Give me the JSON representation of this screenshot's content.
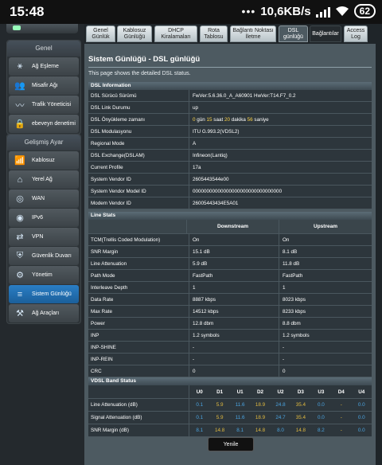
{
  "statusbar": {
    "time": "15:48",
    "dots": "•••",
    "speed": "10,6KB/s",
    "battery": "62"
  },
  "sidebar": {
    "general_title": "Genel",
    "general_items": [
      {
        "label": "Ağ Eşleme",
        "icon": "network-map-icon"
      },
      {
        "label": "Misafir Ağı",
        "icon": "guest-network-icon"
      },
      {
        "label": "Trafik Yöneticisi",
        "icon": "traffic-manager-icon"
      },
      {
        "label": "ebeveyn denetimi",
        "icon": "parental-control-icon"
      }
    ],
    "advanced_title": "Gelişmiş Ayar",
    "advanced_items": [
      {
        "label": "Kablosuz",
        "icon": "wireless-icon"
      },
      {
        "label": "Yerel Ağ",
        "icon": "lan-icon"
      },
      {
        "label": "WAN",
        "icon": "globe-icon"
      },
      {
        "label": "IPv6",
        "icon": "ipv6-globe-icon"
      },
      {
        "label": "VPN",
        "icon": "vpn-icon"
      },
      {
        "label": "Güvenlik Duvarı",
        "icon": "firewall-shield-icon"
      },
      {
        "label": "Yönetim",
        "icon": "administration-gear-icon"
      },
      {
        "label": "Sistem Günlüğü",
        "icon": "system-log-icon"
      },
      {
        "label": "Ağ Araçları",
        "icon": "network-tools-icon"
      }
    ]
  },
  "tabs": [
    {
      "label": "Genel Günlük"
    },
    {
      "label": "Kablosuz Günlüğü"
    },
    {
      "label": "DHCP Kiralamaları"
    },
    {
      "label": "Rota Tablosu"
    },
    {
      "label": "Bağlantı Noktası İletme"
    },
    {
      "label": "DSL günlüğü"
    },
    {
      "label": "Bağlantılar"
    },
    {
      "label": "Access Log"
    }
  ],
  "page": {
    "title": "Sistem Günlüğü - DSL günlüğü",
    "description": "This page shows the detailed DSL status."
  },
  "dsl_info": {
    "title": "DSL Information",
    "rows": [
      {
        "label": "DSL Sürücü Sürümü",
        "value": "FwVer:5.6.36.0_A_A60901 HwVer:T14.F7_0.2"
      },
      {
        "label": "DSL Link Durumu",
        "value": "up"
      },
      {
        "label": "DSL Önyükleme zamanı",
        "value": "0 gün 15 saat 20 dakika 56 saniye"
      },
      {
        "label": "DSL Modulasyonu",
        "value": "ITU G.993.2(VDSL2)"
      },
      {
        "label": "Regional Mode",
        "value": "A"
      },
      {
        "label": "DSL Exchange(DSLAM)",
        "value": "Infineon(Lantiq)"
      },
      {
        "label": "Current Profile",
        "value": "17a"
      },
      {
        "label": "System Vendor ID",
        "value": "2605443544e00"
      },
      {
        "label": "System Vendor Model ID",
        "value": "00000000000000000000000000000000"
      },
      {
        "label": "Modem Vendor ID",
        "value": "26005443434E5A01"
      }
    ],
    "uptime": {
      "d": "0",
      "d_unit": " gün ",
      "h": "15",
      "h_unit": " saat ",
      "m": "20",
      "m_unit": " dakika ",
      "s": "56",
      "s_unit": " saniye"
    }
  },
  "line_stats": {
    "title": "Line Stats",
    "col_down": "Downstream",
    "col_up": "Upstream",
    "rows": [
      {
        "label": "TCM(Trellis Coded Modulation)",
        "down": "On",
        "up": "On"
      },
      {
        "label": "SNR Margin",
        "down": "15.1 dB",
        "up": "8.1 dB"
      },
      {
        "label": "Line Attenuation",
        "down": "5.9 dB",
        "up": "11.8 dB"
      },
      {
        "label": "Path Mode",
        "down": "FastPath",
        "up": "FastPath"
      },
      {
        "label": "Interleave Depth",
        "down": "1",
        "up": "1"
      },
      {
        "label": "Data Rate",
        "down": "8887 kbps",
        "up": "8023 kbps"
      },
      {
        "label": "Max Rate",
        "down": "14512 kbps",
        "up": "8233 kbps"
      },
      {
        "label": "Power",
        "down": "12.8 dbm",
        "up": "8.8 dbm"
      },
      {
        "label": "INP",
        "down": "1.2 symbols",
        "up": "1.2 symbols"
      },
      {
        "label": "INP-SHINE",
        "down": "-",
        "up": "-"
      },
      {
        "label": "INP-REIN",
        "down": "-",
        "up": "-"
      },
      {
        "label": "CRC",
        "down": "0",
        "up": "0"
      }
    ]
  },
  "vdsl_band": {
    "title": "VDSL Band Status",
    "bands": [
      "U0",
      "D1",
      "U1",
      "D2",
      "U2",
      "D3",
      "U3",
      "D4",
      "U4"
    ],
    "rows": [
      {
        "label": "Line Attenuation (dB)",
        "values": [
          "0.1",
          "5.9",
          "11.6",
          "18.9",
          "24.8",
          "35.4",
          "0.0",
          "-",
          "0.0"
        ]
      },
      {
        "label": "Signal Attenuation (dB)",
        "values": [
          "0.1",
          "5.9",
          "11.6",
          "18.9",
          "24.7",
          "35.4",
          "0.0",
          "-",
          "0.0"
        ]
      },
      {
        "label": "SNR Margin (dB)",
        "values": [
          "8.1",
          "14.8",
          "8.1",
          "14.8",
          "8.0",
          "14.8",
          "8.2",
          "-",
          "0.0"
        ]
      }
    ]
  },
  "refresh_label": "Yenile",
  "colors": {
    "accent": "#2a7ec5",
    "value_highlight": "#ffd54a",
    "band_value": "#4aa3e0"
  }
}
